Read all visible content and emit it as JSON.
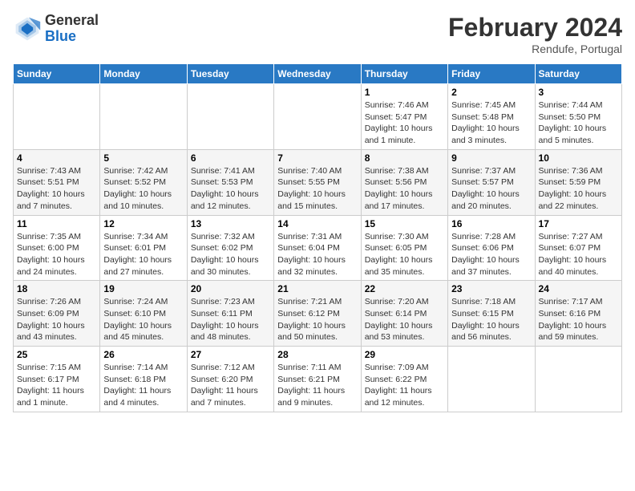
{
  "header": {
    "logo": {
      "general": "General",
      "blue": "Blue"
    },
    "title": "February 2024",
    "subtitle": "Rendufe, Portugal"
  },
  "calendar": {
    "days_of_week": [
      "Sunday",
      "Monday",
      "Tuesday",
      "Wednesday",
      "Thursday",
      "Friday",
      "Saturday"
    ],
    "weeks": [
      [
        {
          "day": "",
          "info": ""
        },
        {
          "day": "",
          "info": ""
        },
        {
          "day": "",
          "info": ""
        },
        {
          "day": "",
          "info": ""
        },
        {
          "day": "1",
          "info": "Sunrise: 7:46 AM\nSunset: 5:47 PM\nDaylight: 10 hours and 1 minute."
        },
        {
          "day": "2",
          "info": "Sunrise: 7:45 AM\nSunset: 5:48 PM\nDaylight: 10 hours and 3 minutes."
        },
        {
          "day": "3",
          "info": "Sunrise: 7:44 AM\nSunset: 5:50 PM\nDaylight: 10 hours and 5 minutes."
        }
      ],
      [
        {
          "day": "4",
          "info": "Sunrise: 7:43 AM\nSunset: 5:51 PM\nDaylight: 10 hours and 7 minutes."
        },
        {
          "day": "5",
          "info": "Sunrise: 7:42 AM\nSunset: 5:52 PM\nDaylight: 10 hours and 10 minutes."
        },
        {
          "day": "6",
          "info": "Sunrise: 7:41 AM\nSunset: 5:53 PM\nDaylight: 10 hours and 12 minutes."
        },
        {
          "day": "7",
          "info": "Sunrise: 7:40 AM\nSunset: 5:55 PM\nDaylight: 10 hours and 15 minutes."
        },
        {
          "day": "8",
          "info": "Sunrise: 7:38 AM\nSunset: 5:56 PM\nDaylight: 10 hours and 17 minutes."
        },
        {
          "day": "9",
          "info": "Sunrise: 7:37 AM\nSunset: 5:57 PM\nDaylight: 10 hours and 20 minutes."
        },
        {
          "day": "10",
          "info": "Sunrise: 7:36 AM\nSunset: 5:59 PM\nDaylight: 10 hours and 22 minutes."
        }
      ],
      [
        {
          "day": "11",
          "info": "Sunrise: 7:35 AM\nSunset: 6:00 PM\nDaylight: 10 hours and 24 minutes."
        },
        {
          "day": "12",
          "info": "Sunrise: 7:34 AM\nSunset: 6:01 PM\nDaylight: 10 hours and 27 minutes."
        },
        {
          "day": "13",
          "info": "Sunrise: 7:32 AM\nSunset: 6:02 PM\nDaylight: 10 hours and 30 minutes."
        },
        {
          "day": "14",
          "info": "Sunrise: 7:31 AM\nSunset: 6:04 PM\nDaylight: 10 hours and 32 minutes."
        },
        {
          "day": "15",
          "info": "Sunrise: 7:30 AM\nSunset: 6:05 PM\nDaylight: 10 hours and 35 minutes."
        },
        {
          "day": "16",
          "info": "Sunrise: 7:28 AM\nSunset: 6:06 PM\nDaylight: 10 hours and 37 minutes."
        },
        {
          "day": "17",
          "info": "Sunrise: 7:27 AM\nSunset: 6:07 PM\nDaylight: 10 hours and 40 minutes."
        }
      ],
      [
        {
          "day": "18",
          "info": "Sunrise: 7:26 AM\nSunset: 6:09 PM\nDaylight: 10 hours and 43 minutes."
        },
        {
          "day": "19",
          "info": "Sunrise: 7:24 AM\nSunset: 6:10 PM\nDaylight: 10 hours and 45 minutes."
        },
        {
          "day": "20",
          "info": "Sunrise: 7:23 AM\nSunset: 6:11 PM\nDaylight: 10 hours and 48 minutes."
        },
        {
          "day": "21",
          "info": "Sunrise: 7:21 AM\nSunset: 6:12 PM\nDaylight: 10 hours and 50 minutes."
        },
        {
          "day": "22",
          "info": "Sunrise: 7:20 AM\nSunset: 6:14 PM\nDaylight: 10 hours and 53 minutes."
        },
        {
          "day": "23",
          "info": "Sunrise: 7:18 AM\nSunset: 6:15 PM\nDaylight: 10 hours and 56 minutes."
        },
        {
          "day": "24",
          "info": "Sunrise: 7:17 AM\nSunset: 6:16 PM\nDaylight: 10 hours and 59 minutes."
        }
      ],
      [
        {
          "day": "25",
          "info": "Sunrise: 7:15 AM\nSunset: 6:17 PM\nDaylight: 11 hours and 1 minute."
        },
        {
          "day": "26",
          "info": "Sunrise: 7:14 AM\nSunset: 6:18 PM\nDaylight: 11 hours and 4 minutes."
        },
        {
          "day": "27",
          "info": "Sunrise: 7:12 AM\nSunset: 6:20 PM\nDaylight: 11 hours and 7 minutes."
        },
        {
          "day": "28",
          "info": "Sunrise: 7:11 AM\nSunset: 6:21 PM\nDaylight: 11 hours and 9 minutes."
        },
        {
          "day": "29",
          "info": "Sunrise: 7:09 AM\nSunset: 6:22 PM\nDaylight: 11 hours and 12 minutes."
        },
        {
          "day": "",
          "info": ""
        },
        {
          "day": "",
          "info": ""
        }
      ]
    ]
  }
}
